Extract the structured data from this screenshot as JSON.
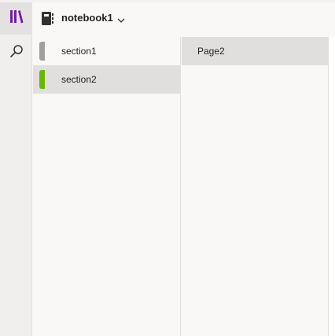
{
  "header": {
    "notebook_name": "notebook1"
  },
  "rail": {
    "library_icon": "library-icon",
    "search_icon": "search-icon"
  },
  "sections": [
    {
      "label": "section1",
      "color": "#a19f9d",
      "selected": false
    },
    {
      "label": "section2",
      "color": "#6bb700",
      "selected": true
    }
  ],
  "pages": [
    {
      "label": "Page2",
      "selected": true
    }
  ],
  "colors": {
    "accent": "#7719aa",
    "selected_bg": "#e1dfdd",
    "pane_bg": "#f9f8f7"
  }
}
